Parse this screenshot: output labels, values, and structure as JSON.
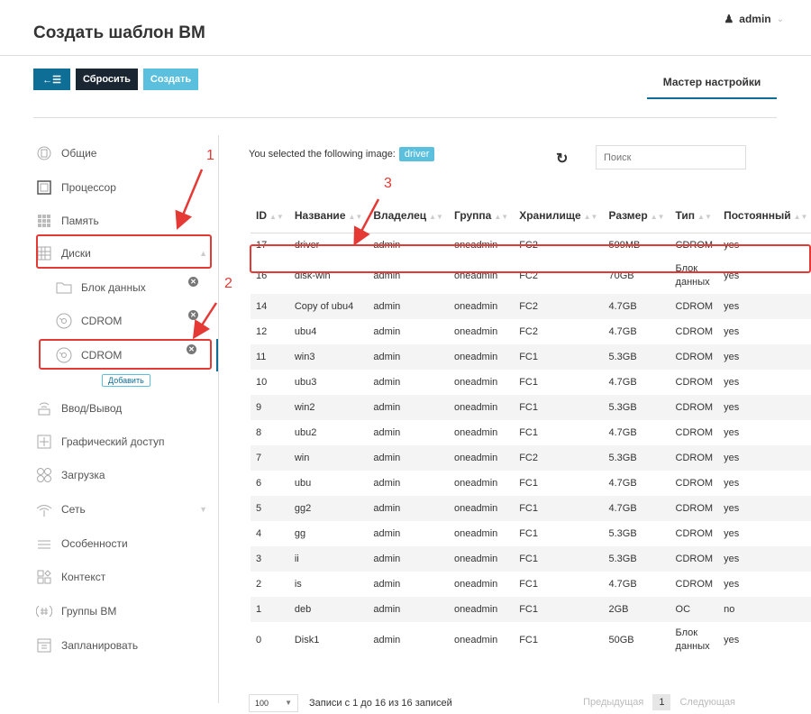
{
  "header": {
    "title": "Создать шаблон ВМ",
    "user": "admin"
  },
  "toolbar": {
    "back_label": "←☰",
    "reset_label": "Сбросить",
    "create_label": "Создать"
  },
  "wizard_tab": "Мастер настройки",
  "sidebar": {
    "items": [
      {
        "label": "Общие",
        "icon": "info-icon"
      },
      {
        "label": "Процессор",
        "icon": "cpu-icon"
      },
      {
        "label": "Память",
        "icon": "memory-icon"
      },
      {
        "label": "Диски",
        "icon": "disk-icon"
      }
    ],
    "sub_items": [
      {
        "label": "Блок данных",
        "icon": "folder-icon"
      },
      {
        "label": "CDROM",
        "icon": "cdrom-icon"
      },
      {
        "label": "CDROM",
        "icon": "cdrom-icon"
      }
    ],
    "add_label": "Добавить",
    "items_after": [
      {
        "label": "Ввод/Вывод",
        "icon": "io-icon"
      },
      {
        "label": "Графический доступ",
        "icon": "graphics-icon"
      },
      {
        "label": "Загрузка",
        "icon": "boot-icon"
      },
      {
        "label": "Сеть",
        "icon": "network-icon"
      },
      {
        "label": "Особенности",
        "icon": "features-icon"
      },
      {
        "label": "Контекст",
        "icon": "context-icon"
      },
      {
        "label": "Группы ВМ",
        "icon": "vmgroup-icon"
      },
      {
        "label": "Запланировать",
        "icon": "schedule-icon"
      }
    ]
  },
  "selection": {
    "text": "You selected the following image:",
    "badge": "driver"
  },
  "search": {
    "placeholder": "Поиск"
  },
  "table": {
    "columns": [
      "ID",
      "Название",
      "Владелец",
      "Группа",
      "Хранилище",
      "Размер",
      "Тип",
      "Постоянный"
    ],
    "rows": [
      [
        "17",
        "driver",
        "admin",
        "oneadmin",
        "FC2",
        "599MB",
        "CDROM",
        "yes"
      ],
      [
        "16",
        "disk-win",
        "admin",
        "oneadmin",
        "FC2",
        "70GB",
        "Блок данных",
        "yes"
      ],
      [
        "14",
        "Copy of ubu4",
        "admin",
        "oneadmin",
        "FC2",
        "4.7GB",
        "CDROM",
        "yes"
      ],
      [
        "12",
        "ubu4",
        "admin",
        "oneadmin",
        "FC2",
        "4.7GB",
        "CDROM",
        "yes"
      ],
      [
        "11",
        "win3",
        "admin",
        "oneadmin",
        "FC1",
        "5.3GB",
        "CDROM",
        "yes"
      ],
      [
        "10",
        "ubu3",
        "admin",
        "oneadmin",
        "FC1",
        "4.7GB",
        "CDROM",
        "yes"
      ],
      [
        "9",
        "win2",
        "admin",
        "oneadmin",
        "FC1",
        "5.3GB",
        "CDROM",
        "yes"
      ],
      [
        "8",
        "ubu2",
        "admin",
        "oneadmin",
        "FC1",
        "4.7GB",
        "CDROM",
        "yes"
      ],
      [
        "7",
        "win",
        "admin",
        "oneadmin",
        "FC2",
        "5.3GB",
        "CDROM",
        "yes"
      ],
      [
        "6",
        "ubu",
        "admin",
        "oneadmin",
        "FC1",
        "4.7GB",
        "CDROM",
        "yes"
      ],
      [
        "5",
        "gg2",
        "admin",
        "oneadmin",
        "FC1",
        "4.7GB",
        "CDROM",
        "yes"
      ],
      [
        "4",
        "gg",
        "admin",
        "oneadmin",
        "FC1",
        "5.3GB",
        "CDROM",
        "yes"
      ],
      [
        "3",
        "ii",
        "admin",
        "oneadmin",
        "FC1",
        "5.3GB",
        "CDROM",
        "yes"
      ],
      [
        "2",
        "is",
        "admin",
        "oneadmin",
        "FC1",
        "4.7GB",
        "CDROM",
        "yes"
      ],
      [
        "1",
        "deb",
        "admin",
        "oneadmin",
        "FC1",
        "2GB",
        "OC",
        "no"
      ],
      [
        "0",
        "Disk1",
        "admin",
        "oneadmin",
        "FC1",
        "50GB",
        "Блок данных",
        "yes"
      ]
    ]
  },
  "footer": {
    "page_size": "100",
    "records": "Записи с 1 до 16 из 16 записей",
    "prev": "Предыдущая",
    "current_page": "1",
    "next": "Следующая"
  },
  "annotations": {
    "n1": "1",
    "n2": "2",
    "n3": "3",
    "color": "#e53935"
  }
}
